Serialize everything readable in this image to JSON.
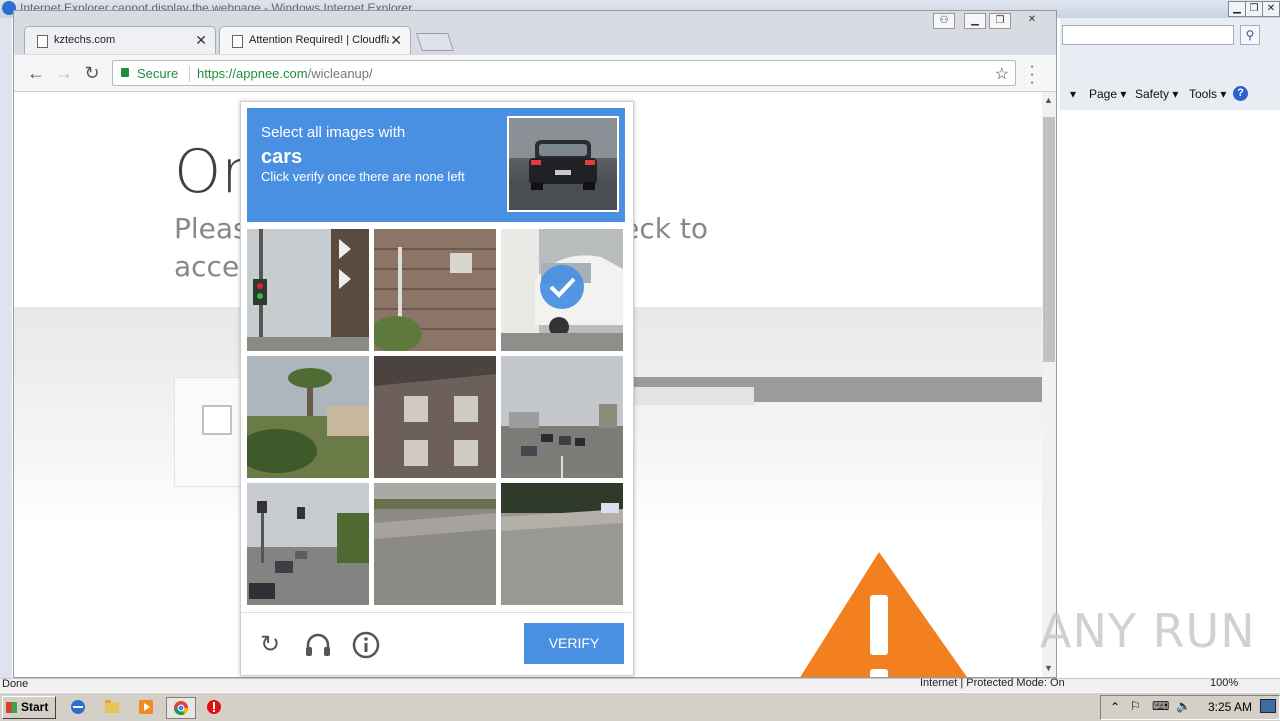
{
  "ie": {
    "window_title": "Internet Explorer cannot display the webpage - Windows Internet Explorer",
    "menu": {
      "page": "Page ▾",
      "safety": "Safety ▾",
      "tools": "Tools ▾",
      "help": "?"
    },
    "status_left": "Done",
    "status_zone": "Internet | Protected Mode: On",
    "zoom": "100%"
  },
  "chrome": {
    "tabs": [
      {
        "title": "kztechs.com",
        "close": "✕"
      },
      {
        "title": "Attention Required! | Cloudflare",
        "close": "✕"
      }
    ],
    "secure_label": "Secure",
    "url_scheme": "https://",
    "url_host": "appnee.com",
    "url_path": "/wicleanup/"
  },
  "page": {
    "heading": "One",
    "paragraph": "Please complete the security check to access appnee.com"
  },
  "recaptcha": {
    "instruction": "Select all images with",
    "target": "cars",
    "hint": "Click verify once there are none left",
    "verify_label": "VERIFY",
    "tiles": [
      {
        "subject": "traffic light pole",
        "selected": false
      },
      {
        "subject": "brick wall",
        "selected": false
      },
      {
        "subject": "white car",
        "selected": true
      },
      {
        "subject": "palm trees",
        "selected": false
      },
      {
        "subject": "building",
        "selected": false
      },
      {
        "subject": "road with cars",
        "selected": false
      },
      {
        "subject": "street intersection",
        "selected": false
      },
      {
        "subject": "road",
        "selected": false
      },
      {
        "subject": "road",
        "selected": false
      }
    ]
  },
  "watermark": "ANY RUN",
  "taskbar": {
    "start_label": "Start",
    "clock": "3:25 AM"
  }
}
